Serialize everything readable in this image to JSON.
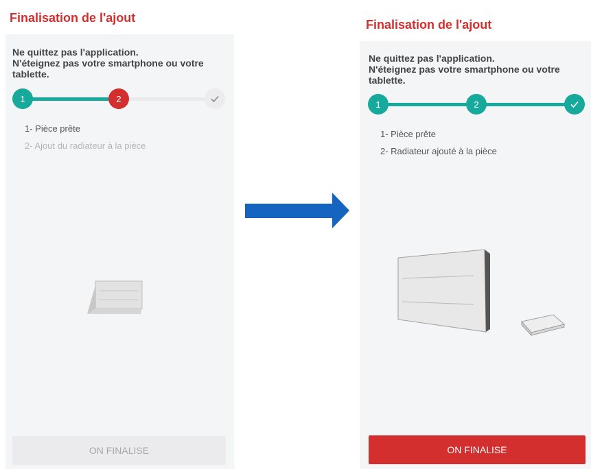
{
  "colors": {
    "accent": "#d32f2f",
    "teal": "#17a99b",
    "panel_bg": "#f4f5f7",
    "arrow": "#1565c0"
  },
  "before": {
    "title": "Finalisation de l'ajout",
    "warning_line1": "Ne quittez pas l'application.",
    "warning_line2": "N'éteignez pas votre smartphone ou votre",
    "warning_line3": "tablette.",
    "stepper": {
      "step1": "1",
      "step2": "2",
      "done_icon": "check-icon"
    },
    "steps": [
      "1- Pièce prête",
      "2- Ajout du radiateur à la pièce"
    ],
    "button": "ON FINALISE"
  },
  "after": {
    "title": "Finalisation de l'ajout",
    "warning_line1": "Ne quittez pas l'application.",
    "warning_line2": "N'éteignez pas votre smartphone ou votre",
    "warning_line3": "tablette.",
    "stepper": {
      "step1": "1",
      "step2": "2",
      "done_icon": "check-icon"
    },
    "steps": [
      "1- Pièce prête",
      "2- Radiateur ajouté à la pièce"
    ],
    "button": "ON FINALISE"
  },
  "transition_icon": "arrow-right-icon"
}
